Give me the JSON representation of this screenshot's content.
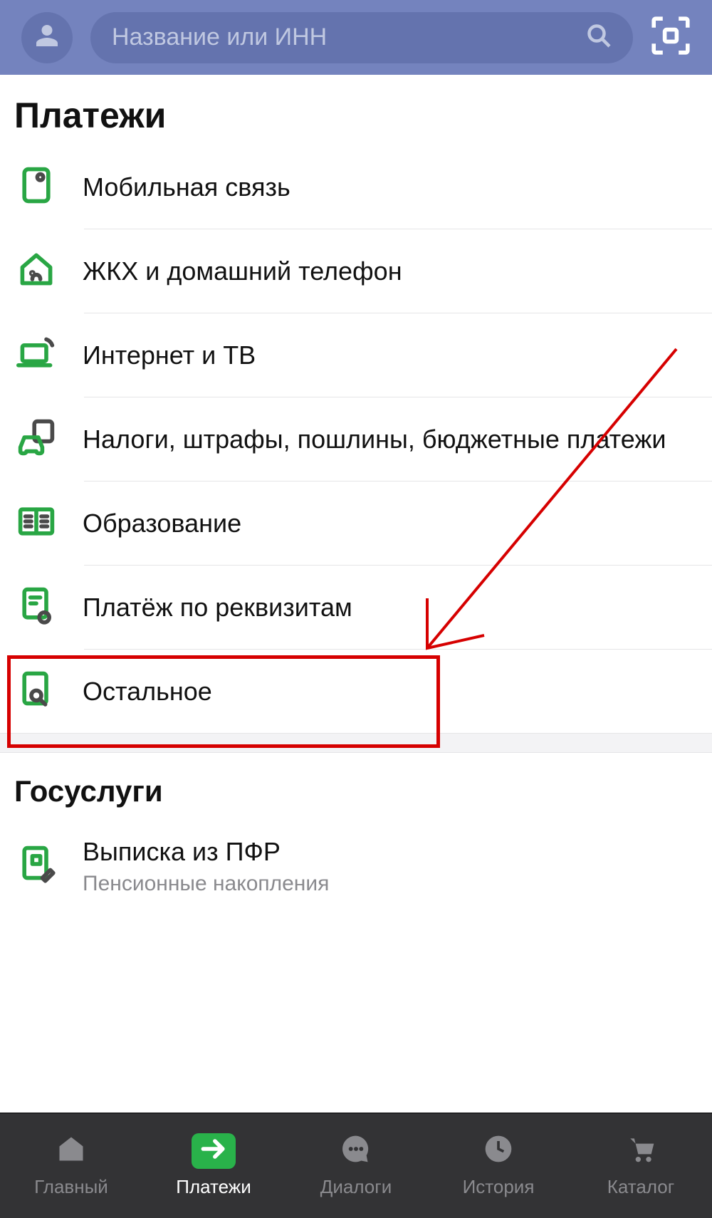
{
  "header": {
    "search_placeholder": "Название или ИНН"
  },
  "sections": {
    "payments": {
      "title": "Платежи",
      "items": [
        {
          "id": "mobile",
          "label": "Мобильная связь"
        },
        {
          "id": "utilities",
          "label": "ЖКХ и домашний телефон"
        },
        {
          "id": "internet",
          "label": "Интернет и ТВ"
        },
        {
          "id": "taxes",
          "label": "Налоги, штрафы, пошлины, бюджетные платежи"
        },
        {
          "id": "education",
          "label": "Образование"
        },
        {
          "id": "requisites",
          "label": "Платёж по реквизитам"
        },
        {
          "id": "other",
          "label": "Остальное"
        }
      ]
    },
    "gosuslugi": {
      "title": "Госуслуги",
      "items": [
        {
          "id": "pfr",
          "label": "Выписка из ПФР",
          "sublabel": "Пенсионные накопления"
        }
      ]
    }
  },
  "tabs": [
    {
      "id": "home",
      "label": "Главный",
      "active": false
    },
    {
      "id": "payments",
      "label": "Платежи",
      "active": true
    },
    {
      "id": "dialogs",
      "label": "Диалоги",
      "active": false
    },
    {
      "id": "history",
      "label": "История",
      "active": false
    },
    {
      "id": "catalog",
      "label": "Каталог",
      "active": false
    }
  ],
  "annotation": {
    "highlighted_item_id": "requisites"
  }
}
